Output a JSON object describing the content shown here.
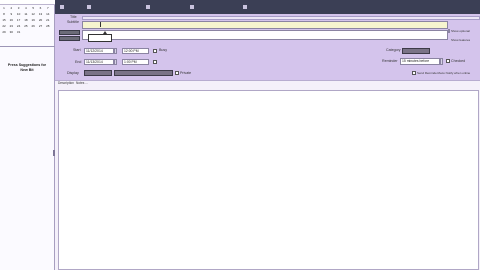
{
  "calendar": {
    "days": [
      "1",
      "2",
      "3",
      "4",
      "5",
      "6",
      "7",
      "8",
      "9",
      "10",
      "11",
      "12",
      "13",
      "14",
      "15",
      "16",
      "17",
      "18",
      "19",
      "20",
      "21",
      "22",
      "23",
      "24",
      "25",
      "26",
      "27",
      "28",
      "29",
      "30",
      "31"
    ]
  },
  "sidebar": {
    "message": "Press Suggestions for New Bit"
  },
  "toolbar": {
    "items": [
      "",
      "",
      "",
      "",
      ""
    ]
  },
  "form": {
    "title_label": "Title",
    "subtitle_label": "Subtitle",
    "option_optional": "Show optional",
    "option_features": "Show features",
    "start_label": "Start",
    "start_date": "11/12/2014",
    "start_time": "12:00 PM",
    "start_check_label": "Busy",
    "end_label": "End",
    "end_date": "11/13/2014",
    "end_time": "1:00 PM",
    "display_label": "Display",
    "display_check_label": "Private",
    "category_label": "Category",
    "reminder_label": "Reminder",
    "reminder_value": "15 minutes before",
    "reminder_check_label": "Checked",
    "right_check_label": "Send Reminder/Auto Notify when online"
  },
  "notes": {
    "label": "Description",
    "value": "Notes ..."
  },
  "colors": {
    "purple_panel": "#d4c4ec",
    "toolbar_dark": "#3b3f55",
    "yellow_field": "#f6f4cf"
  }
}
